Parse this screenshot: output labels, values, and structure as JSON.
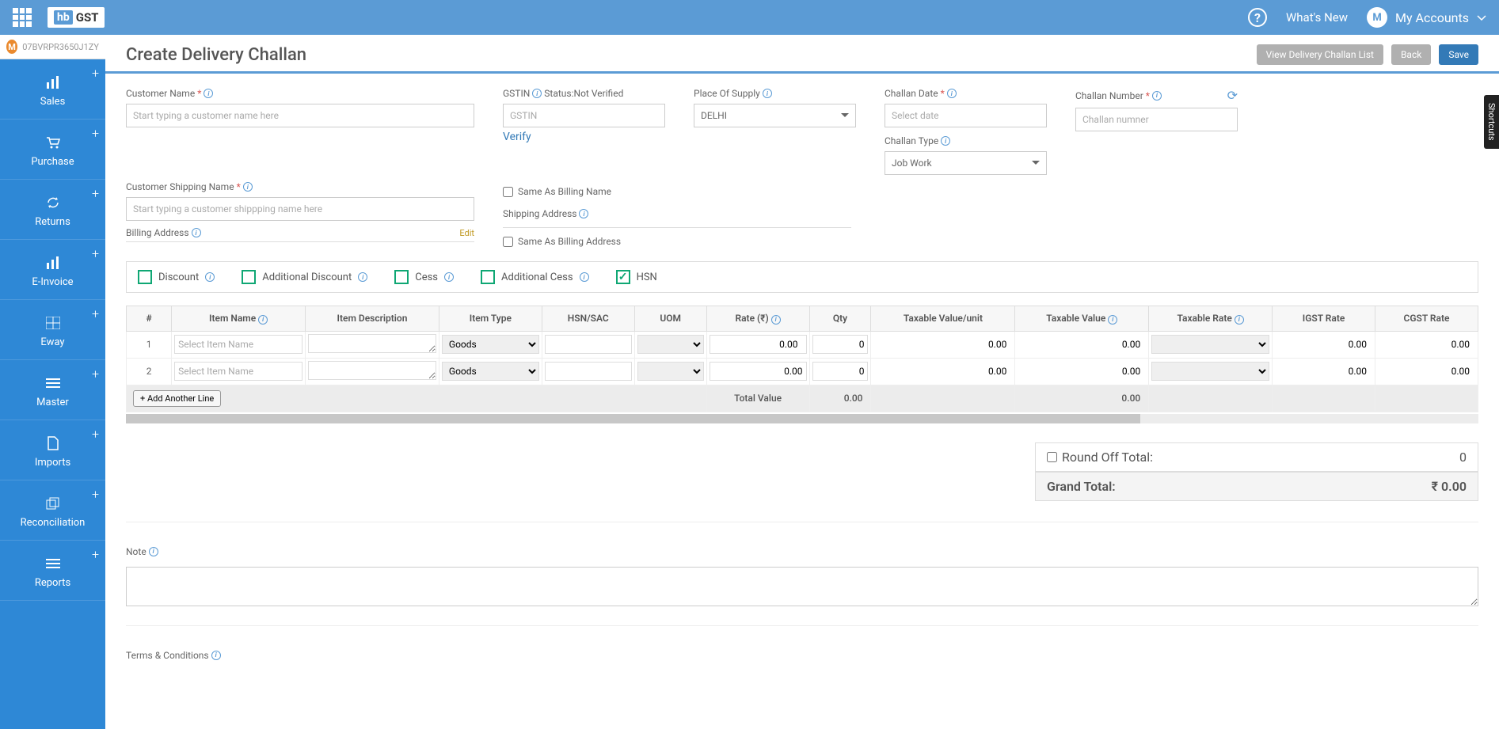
{
  "topbar": {
    "logo_hb": "hb",
    "logo_gst": "GST",
    "whats_new": "What's New",
    "account_initial": "M",
    "account_label": "My Accounts"
  },
  "org": {
    "initial": "M",
    "gstin": "07BVRPR3650J1ZY"
  },
  "sidebar": {
    "items": [
      {
        "label": "Sales"
      },
      {
        "label": "Purchase"
      },
      {
        "label": "Returns"
      },
      {
        "label": "E-Invoice"
      },
      {
        "label": "Eway"
      },
      {
        "label": "Master"
      },
      {
        "label": "Imports"
      },
      {
        "label": "Reconciliation"
      },
      {
        "label": "Reports"
      }
    ]
  },
  "page": {
    "title": "Create Delivery Challan",
    "view_list": "View Delivery Challan List",
    "back": "Back",
    "save": "Save"
  },
  "form": {
    "customer_name_label": "Customer Name",
    "customer_name_ph": "Start typing a customer name here",
    "gstin_label": "GSTIN",
    "gstin_status": "Status:Not Verified",
    "gstin_ph": "GSTIN",
    "verify": "Verify",
    "place_of_supply_label": "Place Of Supply",
    "place_of_supply_value": "DELHI",
    "challan_date_label": "Challan Date",
    "challan_date_ph": "Select date",
    "challan_number_label": "Challan Number",
    "challan_number_ph": "Challan numner",
    "customer_shipping_label": "Customer Shipping Name",
    "customer_shipping_ph": "Start typing a customer shippping name here",
    "billing_address_label": "Billing Address",
    "edit": "Edit",
    "same_as_billing_name": "Same As Billing Name",
    "shipping_address_label": "Shipping Address",
    "same_as_billing_address": "Same As Billing Address",
    "challan_type_label": "Challan Type",
    "challan_type_value": "Job Work"
  },
  "toggles": {
    "discount": "Discount",
    "additional_discount": "Additional Discount",
    "cess": "Cess",
    "additional_cess": "Additional Cess",
    "hsn": "HSN"
  },
  "table": {
    "headers": {
      "num": "#",
      "item_name": "Item Name",
      "item_desc": "Item Description",
      "item_type": "Item Type",
      "hsn": "HSN/SAC",
      "uom": "UOM",
      "rate": "Rate (₹)",
      "qty": "Qty",
      "taxable_value_unit": "Taxable Value/unit",
      "taxable_value": "Taxable Value",
      "taxable_rate": "Taxable Rate",
      "igst_rate": "IGST Rate",
      "cgst_rate": "CGST Rate"
    },
    "item_name_ph": "Select Item Name",
    "item_type_value": "Goods",
    "rows": [
      {
        "num": "1",
        "rate": "0.00",
        "qty": "0",
        "tvu": "0.00",
        "tv": "0.00",
        "igst": "0.00",
        "cgst": "0.00"
      },
      {
        "num": "2",
        "rate": "0.00",
        "qty": "0",
        "tvu": "0.00",
        "tv": "0.00",
        "igst": "0.00",
        "cgst": "0.00"
      }
    ],
    "add_line": "+ Add Another Line",
    "total_value_label": "Total Value",
    "total_rate": "0.00",
    "total_tv": "0.00"
  },
  "totals": {
    "round_off_label": "Round Off Total:",
    "round_off_value": "0",
    "grand_total_label": "Grand Total:",
    "grand_total_value": "₹ 0.00"
  },
  "note": {
    "label": "Note",
    "terms_label": "Terms & Conditions"
  },
  "shortcuts": "Shortcuts"
}
